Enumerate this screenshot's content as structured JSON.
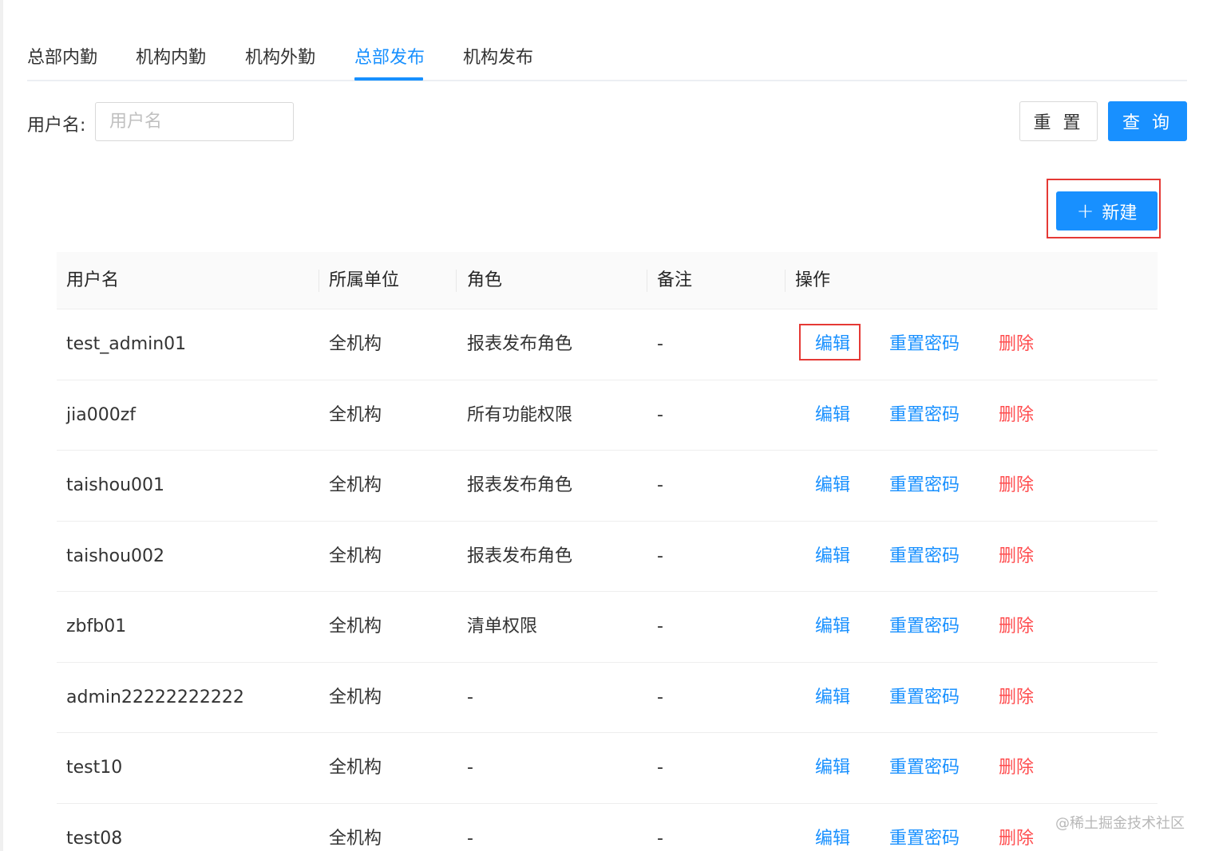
{
  "tabs": [
    {
      "label": "总部内勤",
      "active": false
    },
    {
      "label": "机构内勤",
      "active": false
    },
    {
      "label": "机构外勤",
      "active": false
    },
    {
      "label": "总部发布",
      "active": true
    },
    {
      "label": "机构发布",
      "active": false
    }
  ],
  "search": {
    "label": "用户名:",
    "placeholder": "用户名",
    "value": ""
  },
  "buttons": {
    "reset": "重 置",
    "query": "查 询",
    "new": "新建"
  },
  "table": {
    "columns": [
      "用户名",
      "所属单位",
      "角色",
      "备注",
      "操作"
    ],
    "rows": [
      {
        "username": "test_admin01",
        "unit": "全机构",
        "role": "报表发布角色",
        "remark": "-"
      },
      {
        "username": "jia000zf",
        "unit": "全机构",
        "role": "所有功能权限",
        "remark": "-"
      },
      {
        "username": "taishou001",
        "unit": "全机构",
        "role": "报表发布角色",
        "remark": "-"
      },
      {
        "username": "taishou002",
        "unit": "全机构",
        "role": "报表发布角色",
        "remark": "-"
      },
      {
        "username": "zbfb01",
        "unit": "全机构",
        "role": "清单权限",
        "remark": "-"
      },
      {
        "username": "admin22222222222",
        "unit": "全机构",
        "role": "-",
        "remark": "-"
      },
      {
        "username": "test10",
        "unit": "全机构",
        "role": "-",
        "remark": "-"
      },
      {
        "username": "test08",
        "unit": "全机构",
        "role": "-",
        "remark": "-"
      }
    ],
    "actions": {
      "edit": "编辑",
      "reset_password": "重置密码",
      "delete": "删除"
    }
  },
  "watermark": "@稀土掘金技术社区",
  "colors": {
    "primary": "#1890ff",
    "danger": "#ff4d4f",
    "highlight": "#e53935"
  }
}
